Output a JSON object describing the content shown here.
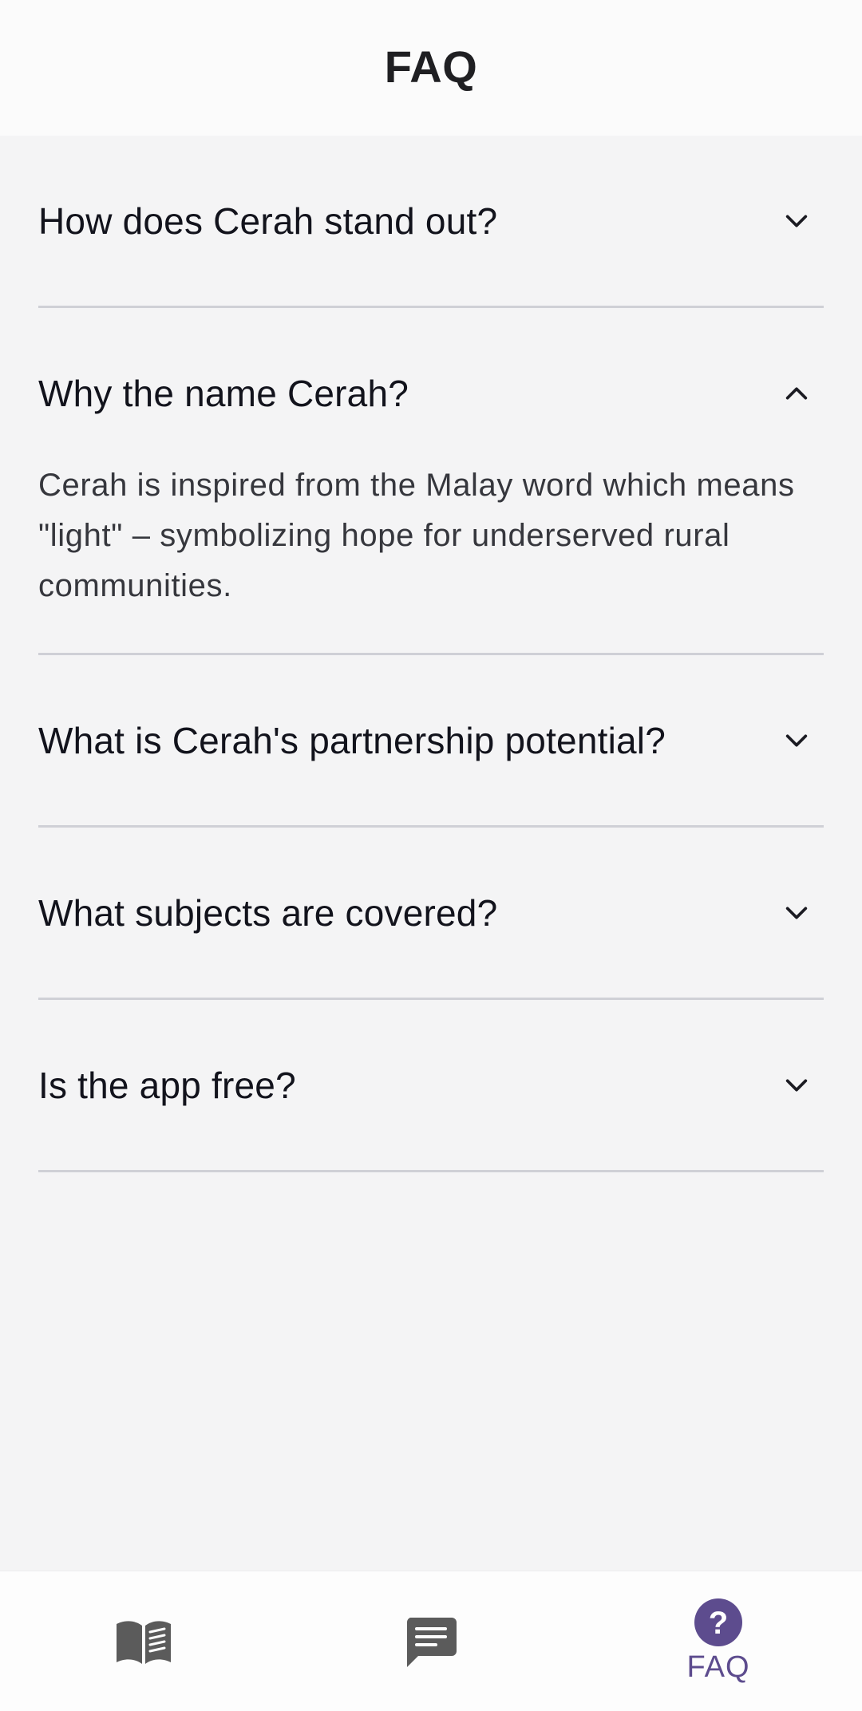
{
  "header": {
    "title": "FAQ"
  },
  "faq": [
    {
      "question": "How does Cerah stand out?",
      "expanded": false
    },
    {
      "question": "Why the name Cerah?",
      "expanded": true,
      "answer": "Cerah is inspired from the Malay word which means \"light\" – symbolizing hope for underserved rural communities."
    },
    {
      "question": "What is Cerah's partnership potential?",
      "expanded": false
    },
    {
      "question": "What subjects are covered?",
      "expanded": false
    },
    {
      "question": "Is the app free?",
      "expanded": false
    }
  ],
  "bottom_nav": {
    "items": [
      {
        "icon": "book-icon",
        "active": false
      },
      {
        "icon": "chat-icon",
        "active": false
      },
      {
        "icon": "help-icon",
        "label": "FAQ",
        "active": true
      }
    ]
  },
  "colors": {
    "accent": "#5d4c8e",
    "inactive_icon": "#5b5b5b",
    "divider": "#cfd0d6"
  }
}
